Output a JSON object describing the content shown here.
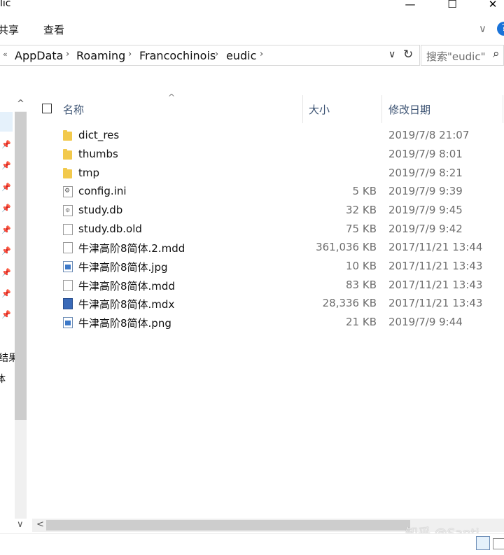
{
  "window": {
    "title": "lic",
    "minimize_glyph": "—",
    "maximize_glyph": "☐",
    "close_glyph": "✕"
  },
  "ribbon": {
    "tabs": [
      "共享",
      "查看"
    ],
    "expand_glyph": "∨",
    "help_glyph": "?"
  },
  "address": {
    "back_glyph": "«",
    "crumbs": [
      "AppData",
      "Roaming",
      "Francochinois",
      "eudic"
    ],
    "sep_glyph": "›",
    "dropdown_glyph": "∨",
    "refresh_glyph": "↻",
    "search_placeholder": "搜索\"eudic\"",
    "search_glyph": "⌕"
  },
  "nav": {
    "partial_labels": [
      "结果",
      "体"
    ],
    "scroll_up_glyph": "^",
    "scroll_down_glyph": "∨"
  },
  "columns": {
    "sort_glyph": "^",
    "name": "名称",
    "size": "大小",
    "modified": "修改日期"
  },
  "files": [
    {
      "name": "dict_res",
      "size": "",
      "date": "2019/7/8 21:07",
      "icon": "folder"
    },
    {
      "name": "thumbs",
      "size": "",
      "date": "2019/7/9 8:01",
      "icon": "folder"
    },
    {
      "name": "tmp",
      "size": "",
      "date": "2019/7/9 8:21",
      "icon": "folder"
    },
    {
      "name": "config.ini",
      "size": "5 KB",
      "date": "2019/7/9 9:39",
      "icon": "config"
    },
    {
      "name": "study.db",
      "size": "32 KB",
      "date": "2019/7/9 9:45",
      "icon": "db"
    },
    {
      "name": "study.db.old",
      "size": "75 KB",
      "date": "2019/7/9 9:42",
      "icon": "doc"
    },
    {
      "name": "牛津高阶8简体.2.mdd",
      "size": "361,036 KB",
      "date": "2017/11/21 13:44",
      "icon": "doc"
    },
    {
      "name": "牛津高阶8简体.jpg",
      "size": "10 KB",
      "date": "2017/11/21 13:43",
      "icon": "image"
    },
    {
      "name": "牛津高阶8简体.mdd",
      "size": "83 KB",
      "date": "2017/11/21 13:43",
      "icon": "doc"
    },
    {
      "name": "牛津高阶8简体.mdx",
      "size": "28,336 KB",
      "date": "2017/11/21 13:43",
      "icon": "mdx"
    },
    {
      "name": "牛津高阶8简体.png",
      "size": "21 KB",
      "date": "2019/7/9 9:44",
      "icon": "image"
    }
  ],
  "hscroll": {
    "left_glyph": "<"
  },
  "watermark": "知乎 @Santi"
}
